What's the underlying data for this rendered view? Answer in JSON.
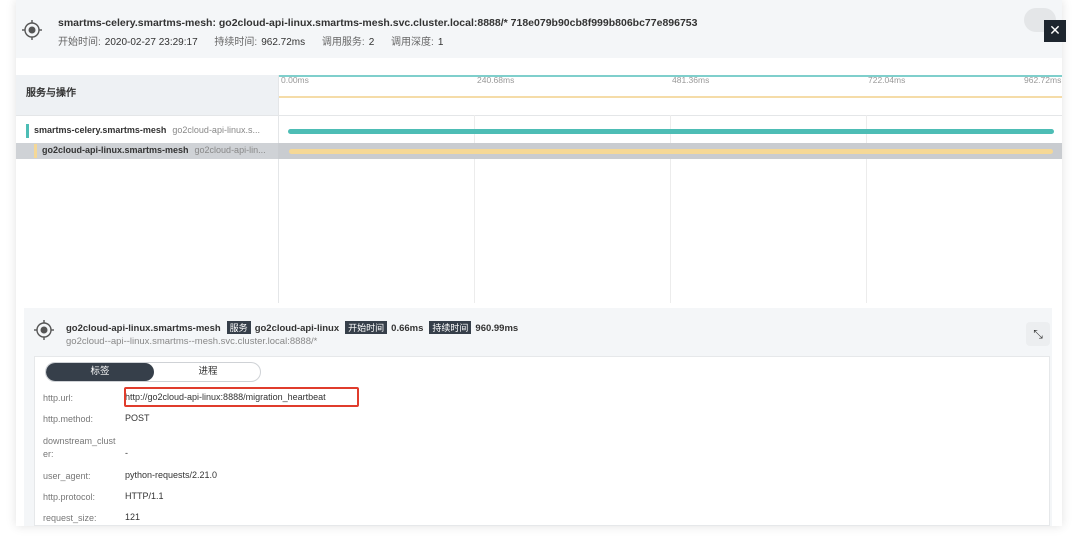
{
  "header": {
    "title": "smartms-celery.smartms-mesh: go2cloud-api-linux.smartms-mesh.svc.cluster.local:8888/* 718e079b90cb8f999b806bc77e896753",
    "start_label": "开始时间:",
    "start_value": "2020-02-27 23:29:17",
    "duration_label": "持续时间:",
    "duration_value": "962.72ms",
    "services_label": "调用服务:",
    "services_value": "2",
    "depth_label": "调用深度:",
    "depth_value": "1",
    "close_label": "✕"
  },
  "timeline": {
    "left_header": "服务与操作",
    "ticks": [
      "0.00ms",
      "240.68ms",
      "481.36ms",
      "722.04ms",
      "962.72ms"
    ],
    "rows": [
      {
        "service": "smartms-celery.smartms-mesh",
        "operation": "go2cloud-api-linux.s...",
        "color": "#4dbdb5",
        "start_ms": 0,
        "duration_ms": 962.72
      },
      {
        "service": "go2cloud-api-linux.smartms-mesh",
        "operation": "go2cloud-api-lin...",
        "color": "#f5d896",
        "start_ms": 0.66,
        "duration_ms": 960.99
      }
    ]
  },
  "detail": {
    "service_name": "go2cloud-api-linux.smartms-mesh",
    "service_tag": "服务",
    "service_value": "go2cloud-api-linux",
    "start_tag": "开始时间",
    "start_value": "0.66ms",
    "duration_tag": "持续时间",
    "duration_value": "960.99ms",
    "operation": "go2cloud--api--linux.smartms--mesh.svc.cluster.local:8888/*",
    "collapse_icon": "⤡",
    "tabs": [
      "标签",
      "进程"
    ],
    "tags": [
      {
        "key": "http.url:",
        "value": "http://go2cloud-api-linux:8888/migration_heartbeat"
      },
      {
        "key": "http.method:",
        "value": "POST"
      },
      {
        "key": "downstream_clust\ner:",
        "value": "-"
      },
      {
        "key": "user_agent:",
        "value": "python-requests/2.21.0"
      },
      {
        "key": "http.protocol:",
        "value": "HTTP/1.1"
      },
      {
        "key": "request_size:",
        "value": "121"
      }
    ]
  }
}
